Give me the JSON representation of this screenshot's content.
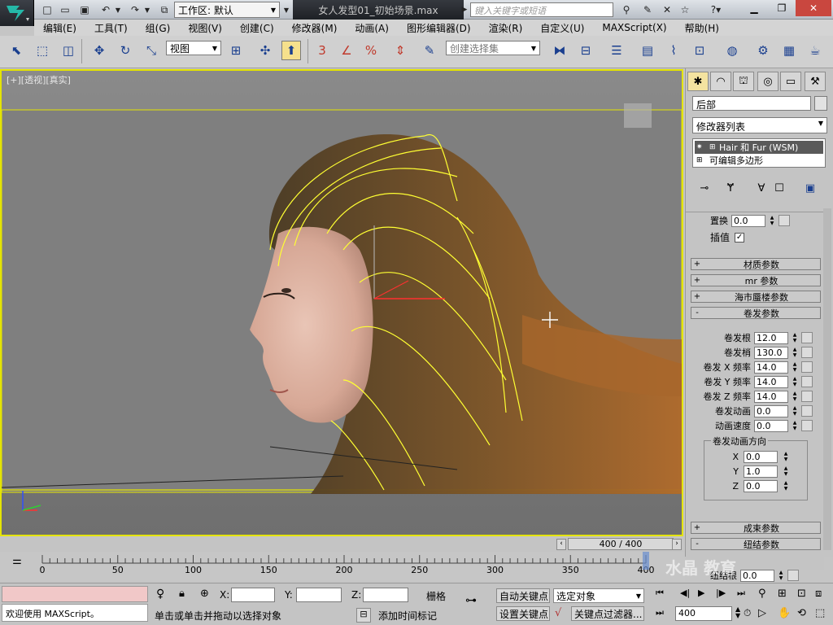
{
  "titlebar": {
    "workspace_label": "工作区: 默认",
    "file_title": "女人发型01_初始场景.max",
    "search_placeholder": "键入关键字或短语"
  },
  "menu": [
    "编辑(E)",
    "工具(T)",
    "组(G)",
    "视图(V)",
    "创建(C)",
    "修改器(M)",
    "动画(A)",
    "图形编辑器(D)",
    "渲染(R)",
    "自定义(U)",
    "MAXScript(X)",
    "帮助(H)"
  ],
  "toolbar": {
    "view_dropdown": "视图",
    "selection_set_placeholder": "创建选择集"
  },
  "viewport": {
    "label": "[+][透视][真实]",
    "accent_color": "#e4e400"
  },
  "command_panel": {
    "object_name": "后部",
    "modifier_list": "修改器列表",
    "stack": [
      "Hair 和 Fur (WSM)",
      "可编辑多边形"
    ],
    "partial_param": {
      "label": "置换",
      "value": "0.0"
    },
    "interpolate": {
      "label": "插值",
      "checked": true
    },
    "rollouts_top": [
      {
        "sign": "+",
        "title": "材质参数"
      },
      {
        "sign": "+",
        "title": "mr 参数"
      },
      {
        "sign": "+",
        "title": "海市蜃楼参数"
      },
      {
        "sign": "-",
        "title": "卷发参数"
      }
    ],
    "curl_params": [
      {
        "label": "卷发根",
        "value": "12.0"
      },
      {
        "label": "卷发梢",
        "value": "130.0"
      },
      {
        "label": "卷发 X 频率",
        "value": "14.0"
      },
      {
        "label": "卷发 Y 频率",
        "value": "14.0"
      },
      {
        "label": "卷发 Z 频率",
        "value": "14.0"
      },
      {
        "label": "卷发动画",
        "value": "0.0"
      },
      {
        "label": "动画速度",
        "value": "0.0"
      }
    ],
    "anim_dir": {
      "title": "卷发动画方向",
      "params": [
        {
          "label": "X",
          "value": "0.0"
        },
        {
          "label": "Y",
          "value": "1.0"
        },
        {
          "label": "Z",
          "value": "0.0"
        }
      ]
    },
    "rollouts_bottom": [
      {
        "sign": "+",
        "title": "成束参数"
      },
      {
        "sign": "-",
        "title": "纽结参数"
      }
    ],
    "kink_root": {
      "label": "纽结根",
      "value": "0.0"
    }
  },
  "timeline": {
    "frame_indicator": "400 / 400",
    "ticks": [
      "0",
      "50",
      "100",
      "150",
      "200",
      "250",
      "300",
      "350",
      "400"
    ]
  },
  "status": {
    "welcome": "欢迎使用 MAXScript。",
    "x_label": "X:",
    "y_label": "Y:",
    "z_label": "Z:",
    "grid_label": "栅格",
    "prompt": "单击或单击并拖动以选择对象",
    "add_time_tag": "添加时间标记",
    "auto_key": "自动关键点",
    "selected_object": "选定对象",
    "set_key": "设置关键点",
    "key_filters": "关键点过滤器...",
    "current_frame": "400"
  },
  "watermark": "水晶 教育"
}
